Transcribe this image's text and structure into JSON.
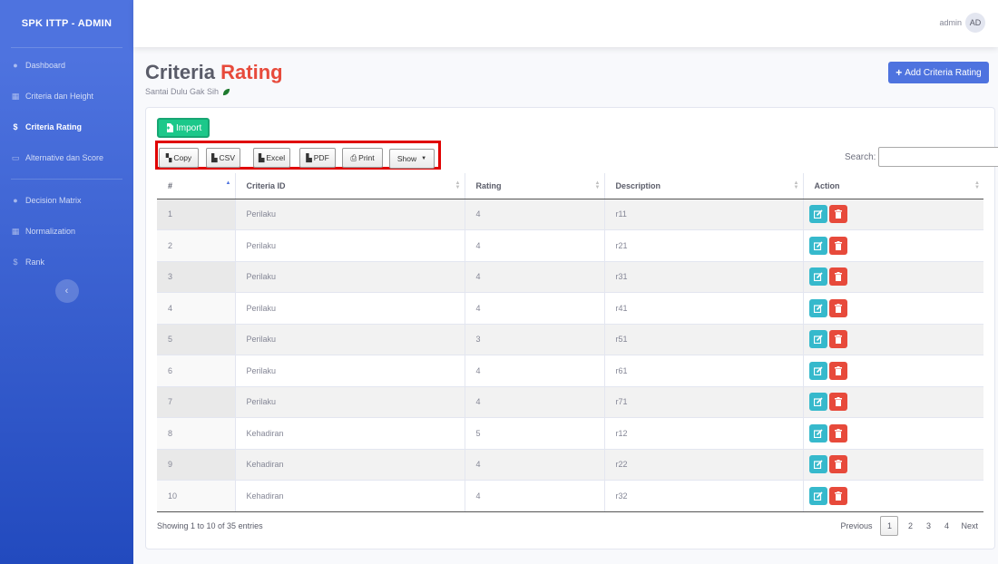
{
  "app": {
    "brand": "SPK ITTP - ADMIN"
  },
  "sidebar": {
    "items": [
      {
        "label": "Dashboard",
        "icon": "palette-icon"
      },
      {
        "label": "Criteria dan Height",
        "icon": "table-icon"
      },
      {
        "label": "Criteria Rating",
        "icon": "dollar-icon",
        "active": true
      },
      {
        "label": "Alternative dan Score",
        "icon": "id-card-icon"
      },
      {
        "label": "Decision Matrix",
        "icon": "palette-icon"
      },
      {
        "label": "Normalization",
        "icon": "table-icon"
      },
      {
        "label": "Rank",
        "icon": "dollar-icon"
      }
    ],
    "toggle_symbol": "‹"
  },
  "topbar": {
    "username": "admin",
    "avatar_initials": "AD"
  },
  "page": {
    "title_main": "Criteria",
    "title_accent": "Rating",
    "subtitle": "Santai Dulu Gak Sih",
    "add_button": "Add Criteria Rating"
  },
  "toolbar": {
    "import_label": "Import",
    "copy_label": "Copy",
    "csv_label": "CSV",
    "excel_label": "Excel",
    "pdf_label": "PDF",
    "print_label": "Print",
    "show_label": "Show",
    "search_label": "Search:",
    "search_value": ""
  },
  "table": {
    "headers": {
      "num": "#",
      "criteria": "Criteria ID",
      "rating": "Rating",
      "description": "Description",
      "action": "Action"
    },
    "rows": [
      {
        "num": "1",
        "criteria": "Perilaku",
        "rating": "4",
        "description": "r11"
      },
      {
        "num": "2",
        "criteria": "Perilaku",
        "rating": "4",
        "description": "r21"
      },
      {
        "num": "3",
        "criteria": "Perilaku",
        "rating": "4",
        "description": "r31"
      },
      {
        "num": "4",
        "criteria": "Perilaku",
        "rating": "4",
        "description": "r41"
      },
      {
        "num": "5",
        "criteria": "Perilaku",
        "rating": "3",
        "description": "r51"
      },
      {
        "num": "6",
        "criteria": "Perilaku",
        "rating": "4",
        "description": "r61"
      },
      {
        "num": "7",
        "criteria": "Perilaku",
        "rating": "4",
        "description": "r71"
      },
      {
        "num": "8",
        "criteria": "Kehadiran",
        "rating": "5",
        "description": "r12"
      },
      {
        "num": "9",
        "criteria": "Kehadiran",
        "rating": "4",
        "description": "r22"
      },
      {
        "num": "10",
        "criteria": "Kehadiran",
        "rating": "4",
        "description": "r32"
      }
    ]
  },
  "footer": {
    "info": "Showing 1 to 10 of 35 entries",
    "previous": "Previous",
    "pages": [
      "1",
      "2",
      "3",
      "4"
    ],
    "current_page": "1",
    "next": "Next"
  },
  "colors": {
    "primary": "#4e73df",
    "success": "#1cc88a",
    "danger": "#e74a3b",
    "info": "#36b9cc",
    "highlight": "#e00000"
  }
}
